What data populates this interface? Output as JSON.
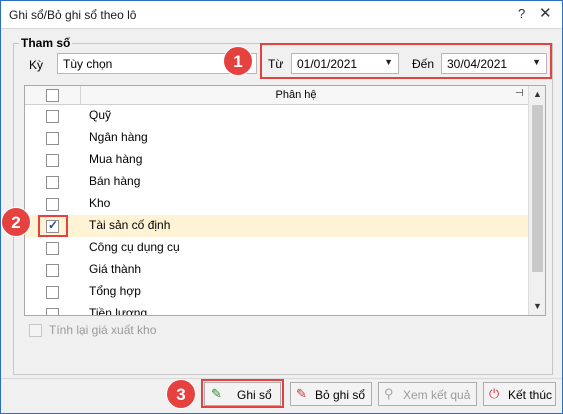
{
  "window": {
    "title": "Ghi sổ/Bỏ ghi sổ theo lô",
    "help_glyph": "?",
    "close_glyph": "✕"
  },
  "params": {
    "group_label": "Tham số",
    "period_label": "Kỳ",
    "period_value": "Tùy chọn",
    "from_label": "Từ",
    "from_value": "01/01/2021",
    "to_label": "Đến",
    "to_value": "30/04/2021"
  },
  "grid": {
    "header": "Phân hệ",
    "rows": [
      {
        "label": "Quỹ",
        "checked": false
      },
      {
        "label": "Ngân hàng",
        "checked": false
      },
      {
        "label": "Mua hàng",
        "checked": false
      },
      {
        "label": "Bán hàng",
        "checked": false
      },
      {
        "label": "Kho",
        "checked": false
      },
      {
        "label": "Tài sản cố định",
        "checked": true
      },
      {
        "label": "Công cụ dụng cụ",
        "checked": false
      },
      {
        "label": "Giá thành",
        "checked": false
      },
      {
        "label": "Tổng hợp",
        "checked": false
      },
      {
        "label": "Tiền lương",
        "checked": false
      }
    ]
  },
  "recalc_label": "Tính lại giá xuất kho",
  "buttons": {
    "post": "Ghi sổ",
    "unpost": "Bỏ ghi sổ",
    "view_result": "Xem kết quả",
    "finish": "Kết thúc"
  },
  "badges": {
    "one": "1",
    "two": "2",
    "three": "3"
  },
  "colors": {
    "highlight": "#e4413f",
    "selected_row": "#fff3d6",
    "window_border": "#2b6fc2"
  }
}
